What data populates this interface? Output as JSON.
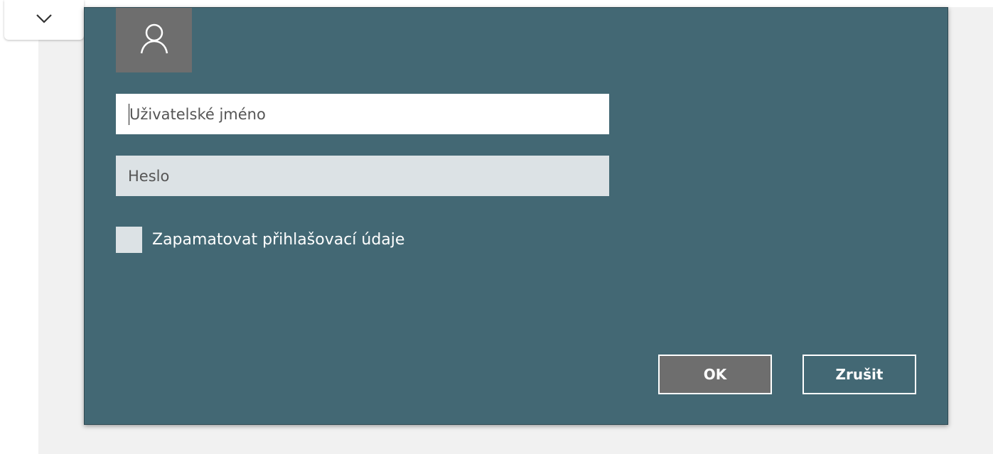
{
  "window": {
    "collapse_icon": "chevron-down-icon"
  },
  "dialog": {
    "avatar_icon": "user-icon",
    "username": {
      "value": "",
      "placeholder": "Uživatelské jméno"
    },
    "password": {
      "value": "",
      "placeholder": "Heslo"
    },
    "remember": {
      "label": "Zapamatovat přihlašovací údaje",
      "checked": false
    },
    "buttons": {
      "ok_label": "OK",
      "cancel_label": "Zrušit"
    }
  },
  "colors": {
    "dialog_background": "#436874",
    "avatar_background": "#6e6e6e",
    "field_disabled": "#dce2e5"
  }
}
